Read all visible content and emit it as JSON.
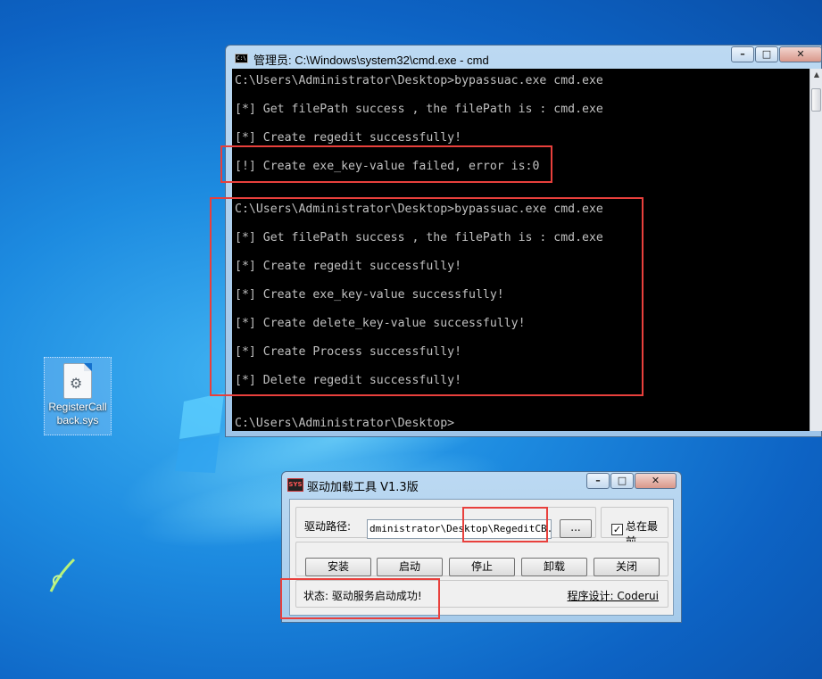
{
  "desktop": {
    "icon": {
      "label": "RegisterCallback.sys",
      "icon": "gear-file-icon"
    }
  },
  "cmd_window": {
    "title": "管理员: C:\\Windows\\system32\\cmd.exe - cmd",
    "controls": {
      "minimize": "–",
      "maximize": "□",
      "close": "✕"
    },
    "lines": [
      "C:\\Users\\Administrator\\Desktop>bypassuac.exe cmd.exe",
      "",
      "[*] Get filePath success , the filePath is : cmd.exe",
      "",
      "[*] Create regedit successfully!",
      "",
      "[!] Create exe_key-value failed, error is:0",
      "",
      "",
      "C:\\Users\\Administrator\\Desktop>bypassuac.exe cmd.exe",
      "",
      "[*] Get filePath success , the filePath is : cmd.exe",
      "",
      "[*] Create regedit successfully!",
      "",
      "[*] Create exe_key-value successfully!",
      "",
      "[*] Create delete_key-value successfully!",
      "",
      "[*] Create Process successfully!",
      "",
      "[*] Delete regedit successfully!",
      "",
      "",
      "C:\\Users\\Administrator\\Desktop>"
    ]
  },
  "driver_tool": {
    "title": "驱动加载工具 V1.3版",
    "icon_text": "SYS",
    "controls": {
      "minimize": "–",
      "maximize": "□",
      "close": "✕"
    },
    "path_label": "驱动路径:",
    "path_value": "dministrator\\Desktop\\RegeditCB.sys",
    "browse_label": "...",
    "always_on_top_label": "总在最前",
    "always_on_top_checked": "✓",
    "buttons": [
      "安装",
      "启动",
      "停止",
      "卸载",
      "关闭"
    ],
    "status": "状态: 驱动服务启动成功!",
    "credit": "程序设计: Coderui"
  },
  "colors": {
    "highlight_box": "#e8403c",
    "console_text": "#c0c0c0",
    "console_bg": "#000000"
  }
}
